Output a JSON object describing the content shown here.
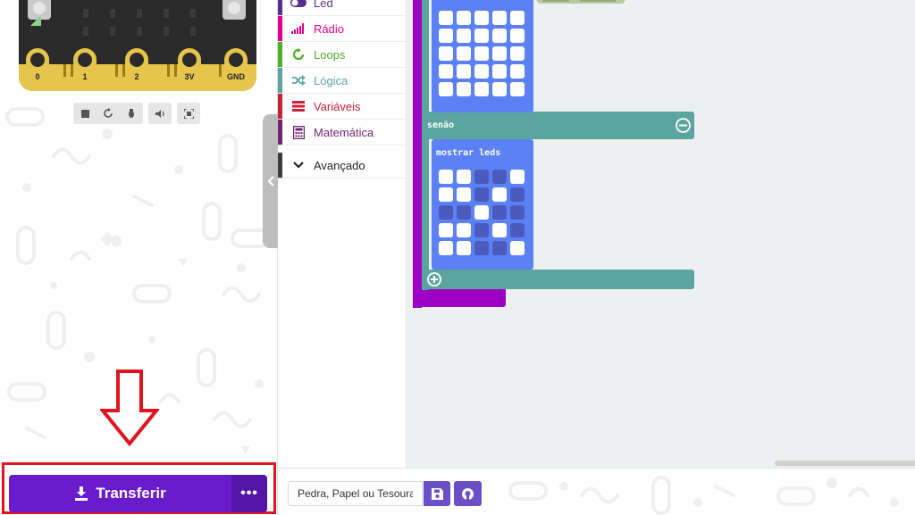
{
  "simulator": {
    "pins": [
      "0",
      "1",
      "2",
      "3V",
      "GND"
    ],
    "controls": [
      "stop-icon",
      "restart-icon",
      "debug-icon",
      "mute-icon",
      "fullscreen-icon"
    ]
  },
  "transfer": {
    "label": "Transferir",
    "more_label": "•••"
  },
  "toolbox": {
    "categories": [
      {
        "label": "Led",
        "color": "#5c2d91"
      },
      {
        "label": "Rádio",
        "color": "#e3008c"
      },
      {
        "label": "Loops",
        "color": "#107c10"
      },
      {
        "label": "Lógica",
        "color": "#006970"
      },
      {
        "label": "Variáveis",
        "color": "#a80000"
      },
      {
        "label": "Matemática",
        "color": "#712672"
      }
    ],
    "advanced": "Avançado"
  },
  "workspace": {
    "else_label": "senão",
    "show_leds_label": "mostrar leds",
    "grid_top": [
      [
        1,
        1,
        1,
        1,
        1
      ],
      [
        1,
        1,
        1,
        1,
        1
      ],
      [
        1,
        1,
        1,
        1,
        1
      ],
      [
        1,
        1,
        1,
        1,
        1
      ],
      [
        1,
        1,
        1,
        1,
        1
      ]
    ],
    "grid_bottom": [
      [
        1,
        1,
        0,
        0,
        1
      ],
      [
        1,
        1,
        0,
        1,
        0
      ],
      [
        0,
        0,
        1,
        0,
        0
      ],
      [
        1,
        1,
        0,
        1,
        0
      ],
      [
        1,
        1,
        0,
        0,
        1
      ]
    ]
  },
  "project": {
    "name": "Pedra, Papel ou Tesoura"
  },
  "colors": {
    "accent": "#6a1ccd",
    "annotation": "#e0141e",
    "logic_block": "#5ca59f",
    "led_block": "#5c81f5",
    "basic_block": "#9d00c4"
  }
}
